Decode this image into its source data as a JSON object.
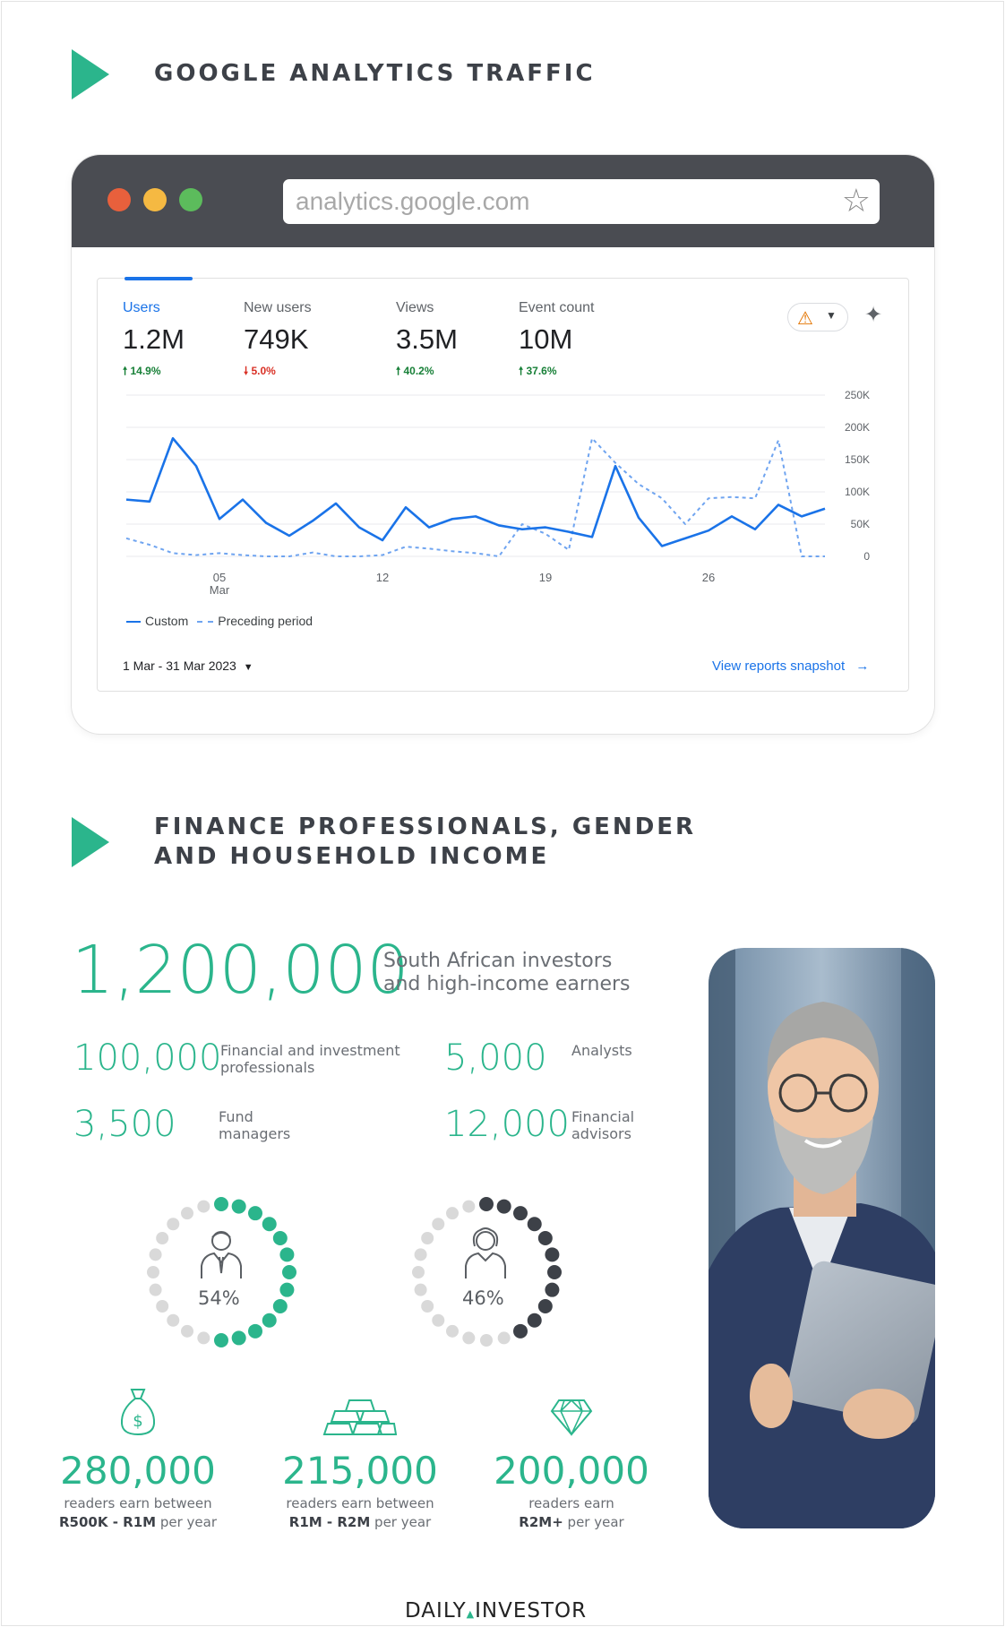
{
  "section1": {
    "title": "GOOGLE ANALYTICS TRAFFIC"
  },
  "browser": {
    "url": "analytics.google.com",
    "dot_colors": [
      "#e8603c",
      "#f5b942",
      "#5cbc5c"
    ]
  },
  "analytics": {
    "metrics": [
      {
        "label": "Users",
        "value": "1.2M",
        "change": "14.9%",
        "direction": "up"
      },
      {
        "label": "New users",
        "value": "749K",
        "change": "5.0%",
        "direction": "down"
      },
      {
        "label": "Views",
        "value": "3.5M",
        "change": "40.2%",
        "direction": "up"
      },
      {
        "label": "Event count",
        "value": "10M",
        "change": "37.6%",
        "direction": "up"
      }
    ],
    "legend": {
      "custom": "Custom",
      "preceding": "Preceding period"
    },
    "date_range": "1 Mar - 31 Mar 2023",
    "view_link": "View reports snapshot"
  },
  "chart_data": {
    "type": "line",
    "x": [
      1,
      2,
      3,
      4,
      5,
      6,
      7,
      8,
      9,
      10,
      11,
      12,
      13,
      14,
      15,
      16,
      17,
      18,
      19,
      20,
      21,
      22,
      23,
      24,
      25,
      26,
      27,
      28,
      29,
      30,
      31
    ],
    "x_tick_labels": [
      {
        "x": 5,
        "label": "05",
        "sub": "Mar"
      },
      {
        "x": 12,
        "label": "12"
      },
      {
        "x": 19,
        "label": "19"
      },
      {
        "x": 26,
        "label": "26"
      }
    ],
    "y_tick_labels": [
      "250K",
      "200K",
      "150K",
      "100K",
      "50K",
      "0"
    ],
    "y_ticks": [
      250000,
      200000,
      150000,
      100000,
      50000,
      0
    ],
    "ylim": [
      0,
      250000
    ],
    "grid": true,
    "series": [
      {
        "name": "Custom",
        "style": "solid",
        "color": "#1a73e8",
        "values": [
          88000,
          85000,
          183000,
          140000,
          58000,
          88000,
          52000,
          32000,
          55000,
          82000,
          45000,
          25000,
          76000,
          45000,
          58000,
          62000,
          48000,
          42000,
          45000,
          38000,
          30000,
          140000,
          60000,
          16000,
          28000,
          40000,
          62000,
          42000,
          80000,
          62000,
          74000
        ]
      },
      {
        "name": "Preceding period",
        "style": "dashed",
        "color": "#6fa4f0",
        "values": [
          28000,
          18000,
          5000,
          2000,
          5000,
          2000,
          0,
          0,
          6000,
          0,
          0,
          2000,
          15000,
          12000,
          8000,
          5000,
          0,
          50000,
          35000,
          10000,
          183000,
          145000,
          112000,
          90000,
          50000,
          90000,
          92000,
          90000,
          180000,
          0,
          0
        ]
      }
    ]
  },
  "section2": {
    "title_line1": "FINANCE PROFESSIONALS, GENDER",
    "title_line2": "AND HOUSEHOLD INCOME"
  },
  "stats": {
    "headline": {
      "value": "1,200,000",
      "desc_line1": "South African investors",
      "desc_line2": "and high-income earners"
    },
    "items": [
      {
        "value": "100,000",
        "desc_line1": "Financial and investment",
        "desc_line2": "professionals"
      },
      {
        "value": "5,000",
        "desc_line1": "Analysts",
        "desc_line2": ""
      },
      {
        "value": "3,500",
        "desc_line1": "Fund",
        "desc_line2": "managers"
      },
      {
        "value": "12,000",
        "desc_line1": "Financial",
        "desc_line2": "advisors"
      }
    ]
  },
  "gender": {
    "male": {
      "percent": "54%",
      "fraction": 0.54,
      "color": "#2bb58c"
    },
    "female": {
      "percent": "46%",
      "fraction": 0.46,
      "color": "#3d4148"
    }
  },
  "income": [
    {
      "value": "280,000",
      "line1": "readers earn between",
      "bold": "R500K - R1M",
      "suffix": " per year",
      "icon": "money-bag-icon"
    },
    {
      "value": "215,000",
      "line1": "readers earn between",
      "bold": "R1M - R2M",
      "suffix": " per year",
      "icon": "gold-bars-icon"
    },
    {
      "value": "200,000",
      "line1": "readers earn",
      "bold": "R2M+",
      "suffix": " per year",
      "icon": "diamond-icon"
    }
  ],
  "brand": {
    "left": "DAILY",
    "right": "INVESTOR"
  }
}
